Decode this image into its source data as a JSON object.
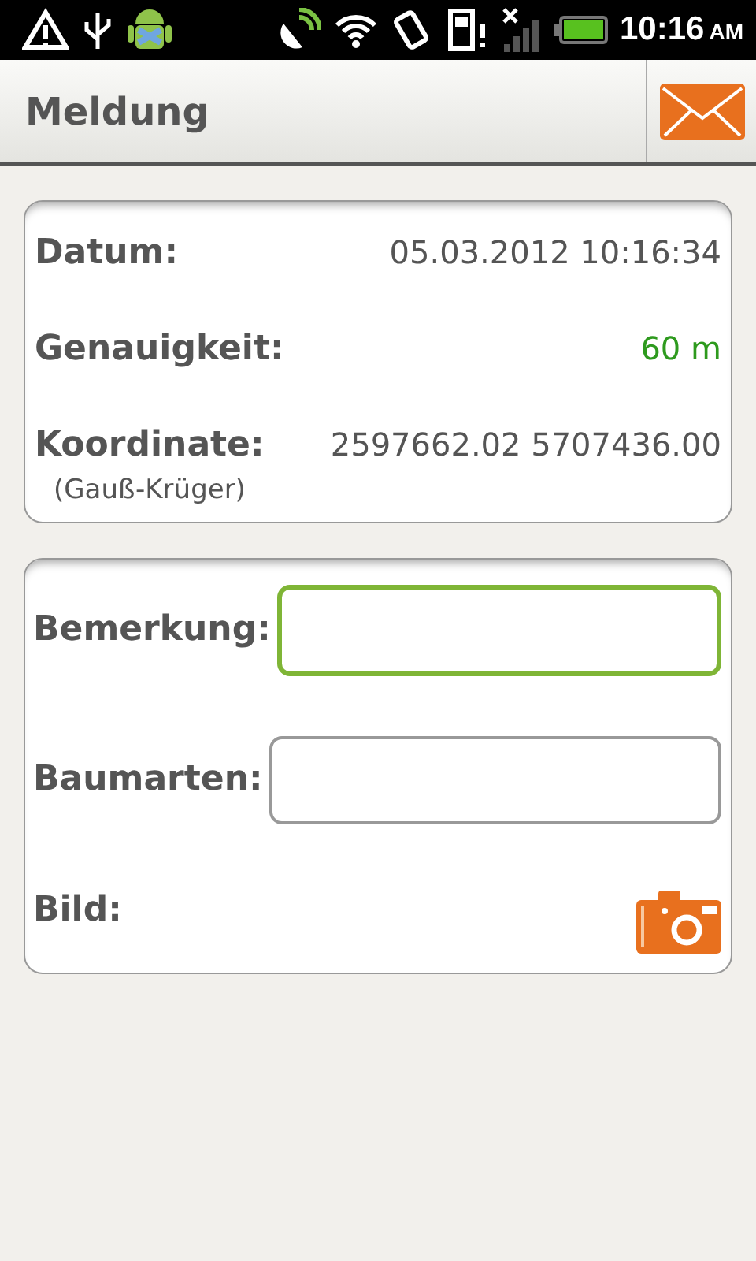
{
  "status_bar": {
    "time": "10:16",
    "meridiem": "AM"
  },
  "title_bar": {
    "title": "Meldung"
  },
  "info": [
    {
      "label": "Datum:",
      "value": "05.03.2012 10:16:34",
      "color": "#555555"
    },
    {
      "label": "Genauigkeit:",
      "value": "60 m",
      "color": "#2e9a1e"
    },
    {
      "label": "Koordinate:",
      "value": "2597662.02 5707436.00",
      "color": "#555555",
      "note": "(Gauß-Krüger)"
    }
  ],
  "form": [
    {
      "kind": "field",
      "label": "Bemerkung:",
      "focused": true
    },
    {
      "kind": "field",
      "label": "Baumarten:",
      "focused": false
    },
    {
      "kind": "photo",
      "label": "Bild:"
    }
  ]
}
